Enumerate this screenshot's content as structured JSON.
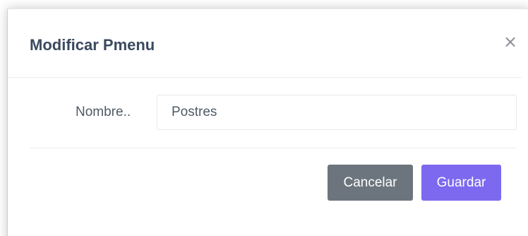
{
  "modal": {
    "title": "Modificar Pmenu",
    "close_symbol": "×",
    "close_icon": "close-icon"
  },
  "form": {
    "name_label": "Nombre..",
    "name_value": "Postres"
  },
  "footer": {
    "cancel_label": "Cancelar",
    "save_label": "Guardar"
  },
  "colors": {
    "title": "#3b4a5e",
    "cancel_button": "#6c757d",
    "save_button": "#7c69ef"
  }
}
